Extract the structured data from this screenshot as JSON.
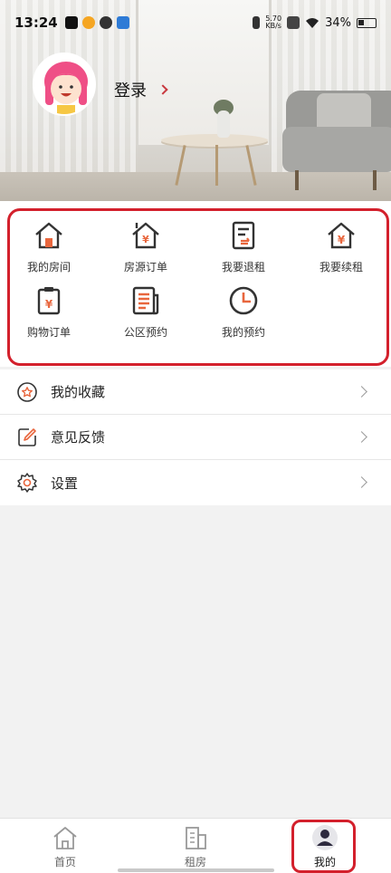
{
  "statusbar": {
    "time": "13:24",
    "net_speed_value": "5.70",
    "net_speed_unit": "KB/s",
    "battery": "34%"
  },
  "profile": {
    "login_label": "登录"
  },
  "quick_actions": [
    {
      "label": "我的房间",
      "icon": "house-icon"
    },
    {
      "label": "房源订单",
      "icon": "house-yen-icon"
    },
    {
      "label": "我要退租",
      "icon": "checkout-doc-icon"
    },
    {
      "label": "我要续租",
      "icon": "renew-house-yen-icon"
    },
    {
      "label": "购物订单",
      "icon": "clipboard-yen-icon"
    },
    {
      "label": "公区预约",
      "icon": "newspaper-icon"
    },
    {
      "label": "我的预约",
      "icon": "clock-icon"
    }
  ],
  "menu": [
    {
      "label": "我的收藏",
      "icon": "favorite-icon"
    },
    {
      "label": "意见反馈",
      "icon": "feedback-edit-icon"
    },
    {
      "label": "设置",
      "icon": "settings-gear-icon"
    }
  ],
  "bottom_nav": [
    {
      "label": "首页",
      "icon": "home-icon"
    },
    {
      "label": "租房",
      "icon": "building-icon"
    },
    {
      "label": "我的",
      "icon": "profile-icon"
    }
  ],
  "colors": {
    "accent": "#e8663d",
    "highlight_outline": "#d3202c",
    "icon_dark": "#333333"
  }
}
